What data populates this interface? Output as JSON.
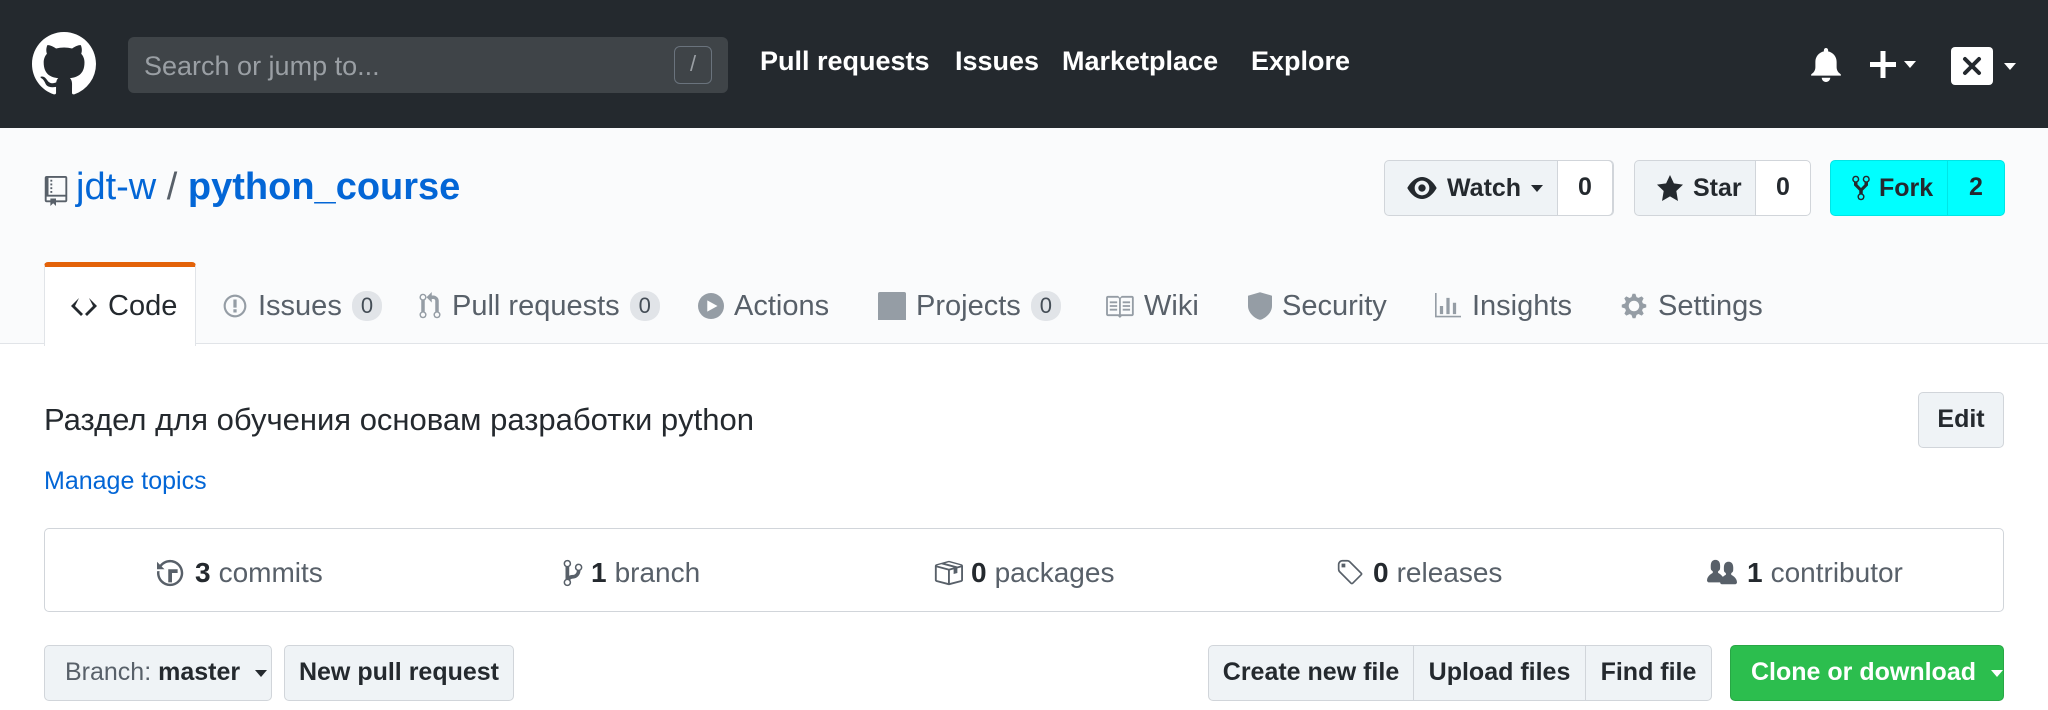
{
  "header": {
    "search_placeholder": "Search or jump to...",
    "search_shortcut": "/",
    "nav": [
      "Pull requests",
      "Issues",
      "Marketplace",
      "Explore"
    ]
  },
  "repo": {
    "owner": "jdt-w",
    "separator": "/",
    "name": "python_course",
    "watch_label": "Watch",
    "watch_count": "0",
    "star_label": "Star",
    "star_count": "0",
    "fork_label": "Fork",
    "fork_count": "2",
    "fork_color": "#00ffff"
  },
  "tabs": [
    {
      "label": "Code",
      "icon": "code-icon"
    },
    {
      "label": "Issues",
      "counter": "0",
      "icon": "issue-icon"
    },
    {
      "label": "Pull requests",
      "counter": "0",
      "icon": "pull-request-icon"
    },
    {
      "label": "Actions",
      "icon": "play-icon"
    },
    {
      "label": "Projects",
      "counter": "0",
      "icon": "project-icon"
    },
    {
      "label": "Wiki",
      "icon": "book-icon"
    },
    {
      "label": "Security",
      "icon": "shield-icon"
    },
    {
      "label": "Insights",
      "icon": "graph-icon"
    },
    {
      "label": "Settings",
      "icon": "gear-icon"
    }
  ],
  "about": {
    "description": "Раздел для обучения основам разработки python",
    "edit_label": "Edit",
    "manage_topics": "Manage topics"
  },
  "summary": [
    {
      "count": "3",
      "label": "commits",
      "icon": "history-icon"
    },
    {
      "count": "1",
      "label": "branch",
      "icon": "branch-icon"
    },
    {
      "count": "0",
      "label": "packages",
      "icon": "package-icon"
    },
    {
      "count": "0",
      "label": "releases",
      "icon": "tag-icon"
    },
    {
      "count": "1",
      "label": "contributor",
      "icon": "people-icon"
    }
  ],
  "toolbar": {
    "branch_prefix": "Branch:",
    "branch_name": "master",
    "new_pull_request": "New pull request",
    "create_new_file": "Create new file",
    "upload_files": "Upload files",
    "find_file": "Find file",
    "clone_or_download": "Clone or download"
  },
  "colors": {
    "header_bg": "#24292e",
    "link": "#0366d6",
    "active_tab_accent": "#e36209",
    "clone_green": "#2cbe4e"
  }
}
